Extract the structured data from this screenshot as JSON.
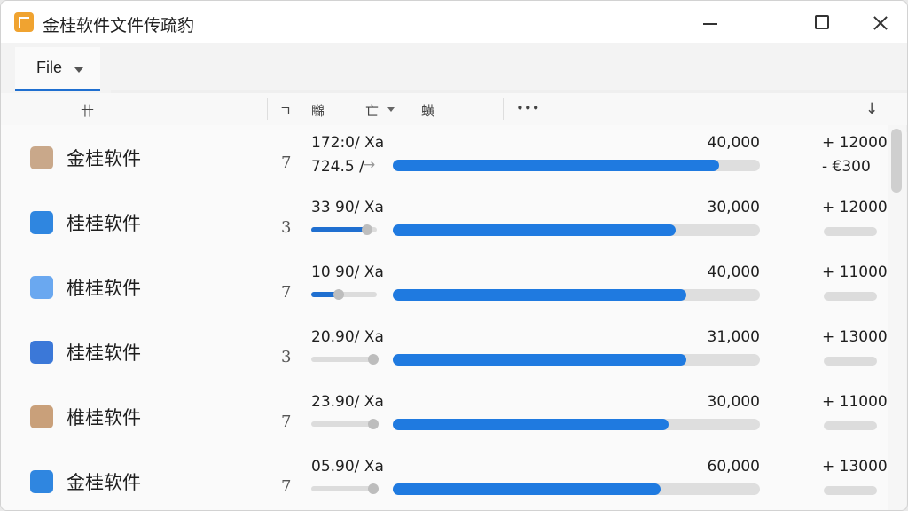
{
  "window": {
    "title": "金桂软件文件传疏豹"
  },
  "menu": {
    "file_label": "File"
  },
  "header": {
    "col1": "卄",
    "col2": "ㄱ",
    "col3": "矊",
    "col4": "亡",
    "col5": "蟥",
    "more": "•••",
    "sort": "↓"
  },
  "rows": [
    {
      "name": "金桂软件",
      "num": "7",
      "stat": "172:0/ Xa",
      "stat2": "724.5 /",
      "value": "40,000",
      "delta": "+ 12000",
      "delta2": "- €300",
      "mini_level": 0,
      "main_level": 0.89,
      "icon": "user-avatar-icon",
      "icon_color": "#c9a88a"
    },
    {
      "name": "桂桂软件",
      "num": "3",
      "stat": "33 90/ Xa",
      "value": "30,000",
      "delta": "+ 12000",
      "mini_level": 0.85,
      "main_level": 0.77,
      "icon": "document-list-icon",
      "icon_color": "#2f86e0"
    },
    {
      "name": "椎桂软件",
      "num": "7",
      "stat": "10 90/ Xa",
      "value": "40,000",
      "delta": "+ 11000",
      "mini_level": 0.42,
      "main_level": 0.8,
      "icon": "chart-trend-icon",
      "icon_color": "#6aa8f0"
    },
    {
      "name": "桂桂软件",
      "num": "3",
      "stat": "20.90/ Xa",
      "value": "31,000",
      "delta": "+ 13000",
      "mini_level": 0,
      "main_level": 0.8,
      "icon": "network-nodes-icon",
      "icon_color": "#3b78d8"
    },
    {
      "name": "椎桂软件",
      "num": "7",
      "stat": "23.90/ Xa",
      "value": "30,000",
      "delta": "+ 11000",
      "mini_level": 0,
      "main_level": 0.75,
      "icon": "verified-document-icon",
      "icon_color": "#c9a07a"
    },
    {
      "name": "金桂软件",
      "num": "7",
      "stat": "05.90/ Xa",
      "value": "60,000",
      "delta": "+ 13000",
      "mini_level": 0,
      "main_level": 0.73,
      "icon": "document-chart-icon",
      "icon_color": "#2f86e0"
    }
  ]
}
